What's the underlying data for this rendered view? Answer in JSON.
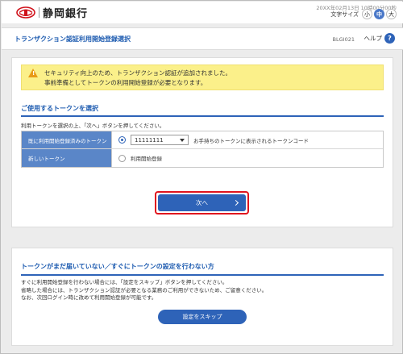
{
  "header": {
    "logo_text": "静岡銀行",
    "datetime": "20XX年02月13日 10時00分00秒",
    "font_size": {
      "label": "文字サイズ",
      "small": "小",
      "medium": "中",
      "large": "大",
      "selected": "medium"
    }
  },
  "titlebar": {
    "title": "トランザクション認証利用開始登録選択",
    "screen_id": "BLGI021",
    "help_label": "ヘルプ",
    "help_icon": "?"
  },
  "warning": {
    "line1": "セキュリティ向上のため、トランザクション認証が追加されました。",
    "line2": "事前準備としてトークンの利用開始登録が必要となります。"
  },
  "token_section": {
    "title": "ご使用するトークンを選択",
    "instruction": "利用トークンを選択の上、「次へ」ボタンを押してください。",
    "rows": [
      {
        "label": "既に利用開始登録済みのトークン",
        "selected": true,
        "select_value": "11111111",
        "hint": "お手持ちのトークンに表示されるトークンコード"
      },
      {
        "label": "新しいトークン",
        "selected": false,
        "option_label": "利用開始登録"
      }
    ],
    "next_label": "次へ"
  },
  "skip_section": {
    "title": "トークンがまだ届いていない／すぐにトークンの設定を行わない方",
    "line1": "すぐに利用開始登録を行わない場合には、「設定をスキップ」ボタンを押してください。",
    "line2": "省略した場合には、トランザクション認証が必要となる業務のご利用ができないため、ご留意ください。",
    "line3": "なお、次回ログイン時に改めて利用開始登録が可能です。",
    "skip_label": "設定をスキップ"
  },
  "colors": {
    "accent": "#2e63b8",
    "highlight": "#e0141e",
    "warning_bg": "#fbf08a",
    "logo_red": "#d0121b"
  }
}
